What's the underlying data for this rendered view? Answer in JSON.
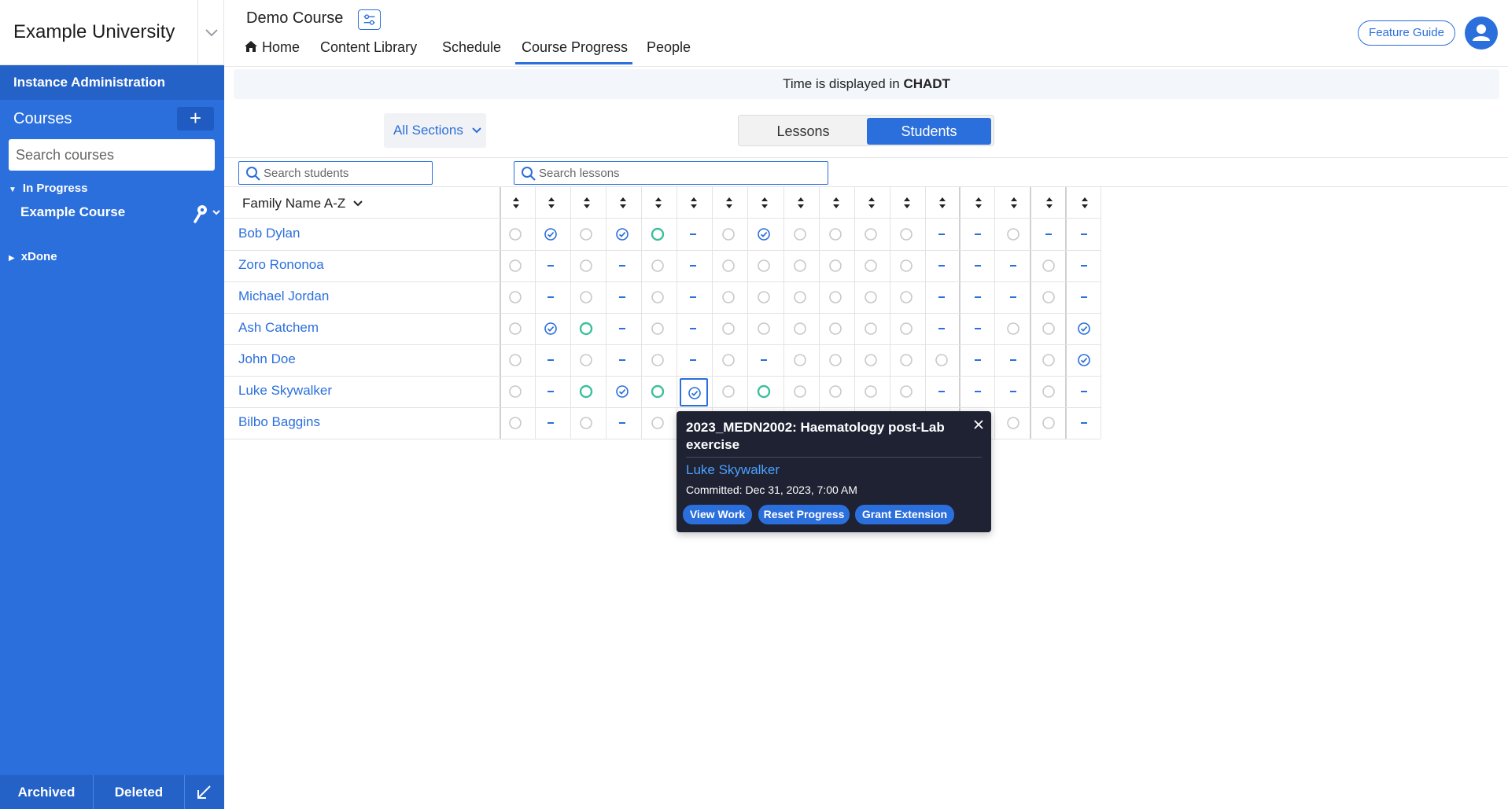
{
  "sidebar": {
    "brand": "Example University",
    "instance_admin": "Instance Administration",
    "courses_label": "Courses",
    "add_symbol": "+",
    "search_placeholder": "Search courses",
    "group_in_progress": "In Progress",
    "course_item": "Example Course",
    "group_done": "xDone",
    "archived": "Archived",
    "deleted": "Deleted"
  },
  "header": {
    "course_title": "Demo Course",
    "nav": [
      "Home",
      "Content Library",
      "Schedule",
      "Course Progress",
      "People"
    ],
    "active_nav": "Course Progress",
    "feature_guide": "Feature Guide"
  },
  "banner": {
    "prefix": "Time is displayed in ",
    "timezone": "CHADT"
  },
  "controls": {
    "sections": "All Sections",
    "toggle": [
      "Lessons",
      "Students"
    ],
    "active_toggle": "Students",
    "search_students_placeholder": "Search students",
    "search_lessons_placeholder": "Search lessons",
    "sort_label": "Family Name A-Z"
  },
  "colors": {
    "primary": "#2b6fdc",
    "sidebar": "#2b6fdc",
    "in_progress_ring": "#3dbf9e",
    "not_started_ring": "#c8c8c8",
    "popover_bg": "#1e2233"
  },
  "status_legend": {
    "o": "not-started",
    "c": "completed",
    "g": "in-progress",
    "d": "not-assigned"
  },
  "students": [
    {
      "name": "Bob Dylan",
      "progress": "ococgdoconooddodd"
    },
    {
      "name": "Zoro Rononoa",
      "progress": "odododoooooodddodd"
    },
    {
      "name": "Michael Jordan",
      "progress": "odododoooooodddodd"
    },
    {
      "name": "Ash Catchem",
      "progress": "ocgdodooooooddoocc"
    },
    {
      "name": "John Doe",
      "progress": "ododododoooooddocc"
    },
    {
      "name": "Luke Skywalker",
      "progress": "odgcgcogoooodddodd"
    },
    {
      "name": "Bilbo Baggins",
      "progress": "odododooooooddoodd"
    }
  ],
  "popover": {
    "title": "2023_MEDN2002: Haematology post-Lab exercise",
    "student": "Luke Skywalker",
    "committed": "Committed: Dec 31, 2023, 7:00 AM",
    "buttons": [
      "View Work",
      "Reset Progress",
      "Grant Extension"
    ]
  }
}
